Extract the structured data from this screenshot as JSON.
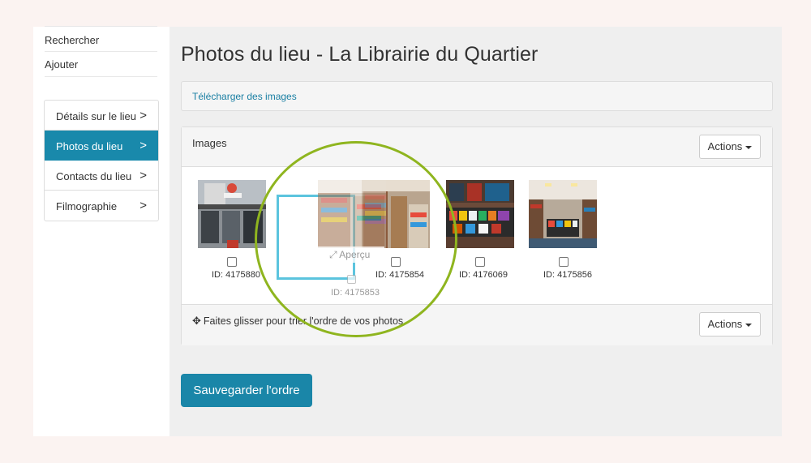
{
  "sidebar": {
    "top_links": [
      {
        "label": "Rechercher"
      },
      {
        "label": "Ajouter"
      }
    ],
    "menu": [
      {
        "label": "Détails sur le lieu",
        "chevron": ">",
        "active": false
      },
      {
        "label": "Photos du lieu",
        "chevron": ">",
        "active": true
      },
      {
        "label": "Contacts du lieu",
        "chevron": ">",
        "active": false
      },
      {
        "label": "Filmographie",
        "chevron": ">",
        "active": false
      }
    ]
  },
  "main": {
    "title": "Photos du lieu - La Librairie du Quartier",
    "upload_link": "Télécharger des images",
    "images_panel": {
      "title": "Images",
      "actions_label": "Actions",
      "thumbnails": [
        {
          "id": "ID: 4175880"
        },
        {
          "id": "ID: 4175854"
        },
        {
          "id": "ID: 4176069"
        },
        {
          "id": "ID: 4175856"
        }
      ],
      "dragging": {
        "preview_label": "Aperçu",
        "id": "ID: 4175853"
      },
      "footer_hint": "Faites glisser pour trier l'ordre de vos photos",
      "footer_actions_label": "Actions"
    },
    "save_button": "Sauvegarder l'ordre"
  },
  "colors": {
    "accent": "#1989ab",
    "link": "#1a7fa3",
    "highlight_ring": "#8fb51f",
    "drop_placeholder": "#5bc4de"
  },
  "icons": {
    "chevron": "chevron-right-icon",
    "caret": "caret-down-icon",
    "move": "move-arrows-icon",
    "expand": "expand-icon"
  }
}
